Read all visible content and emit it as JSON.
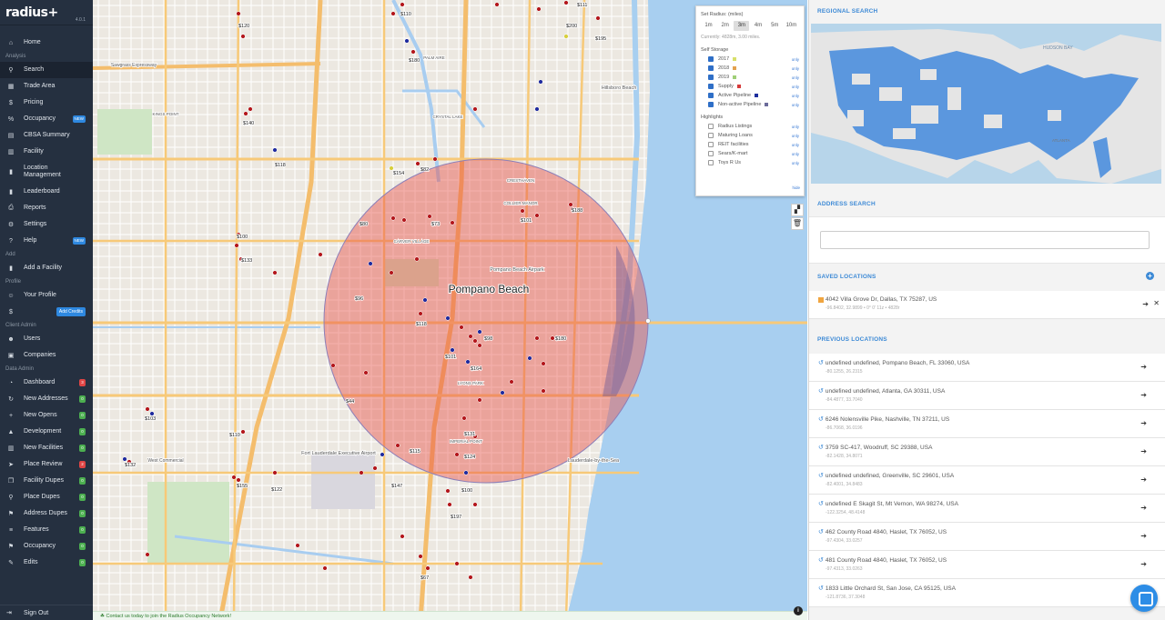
{
  "app": {
    "logo": "radius+",
    "version": "4.0.1"
  },
  "sidebar": {
    "sections": [
      {
        "label": "",
        "items": [
          {
            "label": "Home",
            "icon": "home-icon"
          }
        ]
      },
      {
        "label": "Analysis",
        "items": [
          {
            "label": "Search",
            "icon": "search-icon",
            "active": true
          },
          {
            "label": "Trade Area",
            "icon": "map-icon"
          },
          {
            "label": "Pricing",
            "icon": "dollar-icon"
          },
          {
            "label": "Occupancy",
            "icon": "percent-icon",
            "badge": "NEW"
          },
          {
            "label": "CBSA Summary",
            "icon": "grid-icon"
          },
          {
            "label": "Facility",
            "icon": "building-icon"
          },
          {
            "label": "Location\nManagement",
            "icon": "bookmark-icon"
          },
          {
            "label": "Leaderboard",
            "icon": "bookmark-icon"
          },
          {
            "label": "Reports",
            "icon": "print-icon"
          },
          {
            "label": "Settings",
            "icon": "gear-icon"
          },
          {
            "label": "Help",
            "icon": "question-icon",
            "badge": "NEW"
          }
        ]
      },
      {
        "label": "Add",
        "items": [
          {
            "label": "Add a Facility",
            "icon": "bookmark-icon"
          }
        ]
      },
      {
        "label": "Profile",
        "items": [
          {
            "label": "Your Profile",
            "icon": "user-icon"
          },
          {
            "label": "",
            "icon": "dollar-circle-icon",
            "button": "Add Credits"
          }
        ]
      },
      {
        "label": "Client Admin",
        "items": [
          {
            "label": "Users",
            "icon": "users-icon"
          },
          {
            "label": "Companies",
            "icon": "company-icon"
          }
        ]
      },
      {
        "label": "Data Admin",
        "items": [
          {
            "label": "Dashboard",
            "icon": "dashboard-icon",
            "count": "3",
            "count_color": "red"
          },
          {
            "label": "New Addresses",
            "icon": "refresh-icon",
            "count": "0",
            "count_color": "green"
          },
          {
            "label": "New Opens",
            "icon": "plus-icon",
            "count": "0",
            "count_color": "green"
          },
          {
            "label": "Development",
            "icon": "dev-icon",
            "count": "0",
            "count_color": "green"
          },
          {
            "label": "New Facilities",
            "icon": "building-icon",
            "count": "0",
            "count_color": "green"
          },
          {
            "label": "Place Review",
            "icon": "arrow-icon",
            "count": "2",
            "count_color": "red"
          },
          {
            "label": "Facility Dupes",
            "icon": "copy-icon",
            "count": "0",
            "count_color": "green"
          },
          {
            "label": "Place Dupes",
            "icon": "search-icon",
            "count": "0",
            "count_color": "green"
          },
          {
            "label": "Address Dupes",
            "icon": "pin-icon",
            "count": "0",
            "count_color": "green"
          },
          {
            "label": "Features",
            "icon": "list-icon",
            "count": "0",
            "count_color": "green"
          },
          {
            "label": "Occupancy",
            "icon": "pin-icon",
            "count": "0",
            "count_color": "green"
          },
          {
            "label": "Edits",
            "icon": "edit-icon",
            "count": "0",
            "count_color": "green"
          }
        ]
      }
    ],
    "signout": "Sign Out"
  },
  "map": {
    "city_label": "Pompano Beach",
    "place_labels": [
      {
        "text": "Pompano Beach Airpark"
      },
      {
        "text": "Lauderdale-by-the-Sea"
      },
      {
        "text": "Fort Lauderdale Executive Airport"
      },
      {
        "text": "Hillsboro Beach"
      },
      {
        "text": "CRESTHAVEN"
      },
      {
        "text": "COLLIER MANOR"
      },
      {
        "text": "CARVER VILLAGE"
      },
      {
        "text": "LYONS PARK"
      },
      {
        "text": "IMPERIAL POINT"
      },
      {
        "text": "West Commercial"
      },
      {
        "text": "CRYSTAL LAKE"
      },
      {
        "text": "KINGS POINT"
      },
      {
        "text": "PALM AIRE"
      },
      {
        "text": "Sawgrass Expressway"
      }
    ],
    "price_labels": [
      "$110",
      "$120",
      "$180",
      "$111",
      "$200",
      "$195",
      "$140",
      "$118",
      "$154",
      "$82",
      "$188",
      "$101",
      "$73",
      "$80",
      "$100",
      "$133",
      "$96",
      "$118",
      "$98",
      "$180",
      "$101",
      "$164",
      "$44",
      "$103",
      "$110",
      "$131",
      "$115",
      "$124",
      "$100",
      "$147",
      "$197",
      "$132",
      "$155",
      "$122",
      "$67"
    ],
    "footer_text": "Contact us today to join the Radius Occupancy Network!"
  },
  "radius_panel": {
    "title": "Set Radius: (miles)",
    "options": [
      "1m",
      "2m",
      "3m",
      "4m",
      "5m",
      "10m"
    ],
    "selected": "3m",
    "current": "Currently: 4828m, 3.00 miles.",
    "self_storage_title": "Self Storage",
    "self_storage": [
      {
        "label": "2017",
        "checked": true,
        "color": "#d8e06a"
      },
      {
        "label": "2018",
        "checked": true,
        "color": "#e3a14e"
      },
      {
        "label": "2019",
        "checked": true,
        "color": "#9fcf77"
      },
      {
        "label": "Supply",
        "checked": true,
        "color": "#d63a3a"
      },
      {
        "label": "Active Pipeline",
        "checked": true,
        "color": "#1e2f9e"
      },
      {
        "label": "Non-active Pipeline",
        "checked": true,
        "color": "#6b6b9a"
      }
    ],
    "highlights_title": "Highlights",
    "highlights": [
      {
        "label": "Radius Listings",
        "checked": false
      },
      {
        "label": "Maturing Loans",
        "checked": false
      },
      {
        "label": "REIT facilities",
        "checked": false
      },
      {
        "label": "Sears/K-mart",
        "checked": false
      },
      {
        "label": "Toys R Us",
        "checked": false
      }
    ],
    "only_label": "only",
    "hide_label": "hide"
  },
  "right_panel": {
    "regional_search": "REGIONAL SEARCH",
    "address_search": "ADDRESS SEARCH",
    "address_placeholder": "",
    "saved_locations": "SAVED LOCATIONS",
    "saved": [
      {
        "address": "4042 Villa Grove Dr, Dallas, TX 75287, US",
        "coords": "-96.8402, 32.9899 • 0° 0' 11z • 4828r"
      }
    ],
    "previous_locations": "PREVIOUS LOCATIONS",
    "previous": [
      {
        "address": "undefined undefined, Pompano Beach, FL 33060, USA",
        "coords": "-80.1255, 26.2315"
      },
      {
        "address": "undefined undefined, Atlanta, GA 30311, USA",
        "coords": "-84.4877, 33.7040"
      },
      {
        "address": "6246 Nolensville Pike, Nashville, TN 37211, US",
        "coords": "-86.7068, 36.0196"
      },
      {
        "address": "3759 SC-417, Woodruff, SC 29388, USA",
        "coords": "-82.1428, 34.8071"
      },
      {
        "address": "undefined undefined, Greenville, SC 29601, USA",
        "coords": "-82.4001, 34.8483"
      },
      {
        "address": "undefined E Skagit St, Mt Vernon, WA 98274, USA",
        "coords": "-122.3254, 48.4148"
      },
      {
        "address": "462 County Road 4840, Haslet, TX 76052, US",
        "coords": "-97.4304, 33.0257"
      },
      {
        "address": "481 County Road 4840, Haslet, TX 76052, US",
        "coords": "-97.4313, 33.0263"
      },
      {
        "address": "1833 Little Orchard St, San Jose, CA 95125, USA",
        "coords": "-121.8736, 37.3048"
      }
    ]
  }
}
